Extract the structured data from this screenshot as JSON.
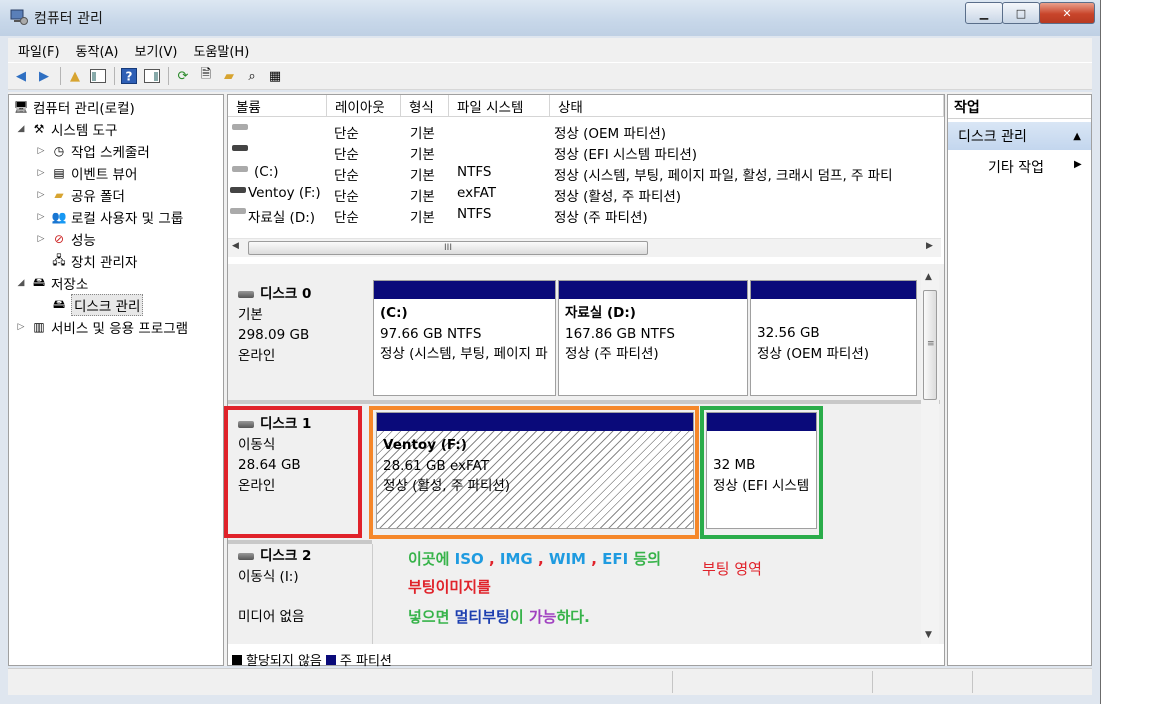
{
  "window": {
    "title": "컴퓨터 관리"
  },
  "menu": [
    "파일(F)",
    "동작(A)",
    "보기(V)",
    "도움말(H)"
  ],
  "tree": {
    "root": "컴퓨터 관리(로컬)",
    "system_tools": "시스템 도구",
    "task_scheduler": "작업 스케줄러",
    "event_viewer": "이벤트 뷰어",
    "shared_folders": "공유 폴더",
    "local_users": "로컬 사용자 및 그룹",
    "performance": "성능",
    "device_manager": "장치 관리자",
    "storage": "저장소",
    "disk_management": "디스크 관리",
    "services": "서비스 및 응용 프로그램"
  },
  "volume_list": {
    "columns": [
      "볼륨",
      "레이아웃",
      "형식",
      "파일 시스템",
      "상태"
    ],
    "rows": [
      {
        "volume": "",
        "layout": "단순",
        "type": "기본",
        "fs": "",
        "status": "정상 (OEM 파티션)"
      },
      {
        "volume": "",
        "layout": "단순",
        "type": "기본",
        "fs": "",
        "status": "정상 (EFI 시스템 파티션)"
      },
      {
        "volume": "(C:)",
        "layout": "단순",
        "type": "기본",
        "fs": "NTFS",
        "status": "정상 (시스템, 부팅, 페이지 파일, 활성, 크래시 덤프, 주 파티"
      },
      {
        "volume": "Ventoy (F:)",
        "layout": "단순",
        "type": "기본",
        "fs": "exFAT",
        "status": "정상 (활성, 주 파티션)"
      },
      {
        "volume": "자료실 (D:)",
        "layout": "단순",
        "type": "기본",
        "fs": "NTFS",
        "status": "정상 (주 파티션)"
      }
    ],
    "scroll_mark": "III"
  },
  "disks": [
    {
      "name": "디스크 0",
      "kind": "기본",
      "size": "298.09 GB",
      "state": "온라인",
      "partitions": [
        {
          "label": "(C:)",
          "size": "97.66 GB NTFS",
          "status": "정상 (시스템, 부팅, 페이지 파일"
        },
        {
          "label": "자료실  (D:)",
          "size": "167.86 GB NTFS",
          "status": "정상 (주 파티션)"
        },
        {
          "label": "",
          "size": "32.56 GB",
          "status": "정상 (OEM 파티션)"
        }
      ]
    },
    {
      "name": "디스크 1",
      "kind": "이동식",
      "size": "28.64 GB",
      "state": "온라인",
      "partitions": [
        {
          "label": "Ventoy  (F:)",
          "size": "28.61 GB exFAT",
          "status": "정상 (활성, 주 파티션)"
        },
        {
          "label": "",
          "size": "32 MB",
          "status": "정상 (EFI 시스템 파티션)"
        }
      ]
    },
    {
      "name": "디스크 2",
      "kind": "이동식 (I:)",
      "size": "",
      "state": "미디어 없음",
      "partitions": []
    }
  ],
  "annotations": {
    "line1": {
      "a": "이곳에 ",
      "b": "ISO",
      "c": " , ",
      "d": "IMG",
      "e": " , ",
      "f": "WIM",
      "g": " , ",
      "h": "EFI",
      "i": " 등의"
    },
    "line2": "부팅이미지를",
    "line3": {
      "a": "넣으면 ",
      "b": "멀티부팅",
      "c": "이 ",
      "d": "가능",
      "e": "하다."
    },
    "boot_area": "부팅 영역"
  },
  "legend": {
    "unallocated": "할당되지 않음",
    "primary": "주 파티션"
  },
  "actions": {
    "header": "작업",
    "selected": "디스크 관리",
    "more": "기타 작업"
  },
  "colors": {
    "partition_bar": "#0a0a7a",
    "red_box": "#e0222a",
    "orange_box": "#f5872a",
    "green_box": "#2aac4a"
  }
}
